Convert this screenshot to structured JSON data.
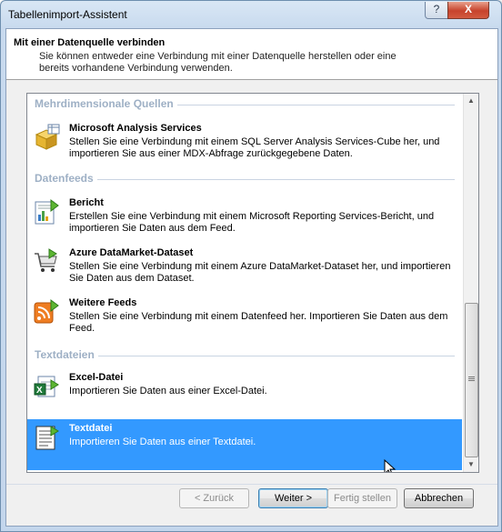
{
  "window": {
    "title": "Tabellenimport-Assistent",
    "help_glyph": "?",
    "close_glyph": "X"
  },
  "header": {
    "title": "Mit einer Datenquelle verbinden",
    "description": "Sie können entweder eine Verbindung mit einer Datenquelle herstellen oder eine bereits vorhandene Verbindung verwenden."
  },
  "groups": {
    "multidim": "Mehrdimensionale Quellen",
    "feeds": "Datenfeeds",
    "text": "Textdateien"
  },
  "items": [
    {
      "name": "Microsoft Analysis Services",
      "desc": "Stellen Sie eine Verbindung mit einem SQL Server Analysis Services-Cube her, und importieren Sie aus einer MDX-Abfrage zurückgegebene Daten.",
      "icon": "cube-icon"
    },
    {
      "name": "Bericht",
      "desc": "Erstellen Sie eine Verbindung mit einem Microsoft Reporting Services-Bericht, und importieren Sie Daten aus dem Feed.",
      "icon": "report-icon"
    },
    {
      "name": "Azure DataMarket-Dataset",
      "desc": "Stellen Sie eine Verbindung mit einem Azure DataMarket-Dataset her, und importieren Sie Daten aus dem Dataset.",
      "icon": "cart-icon"
    },
    {
      "name": "Weitere Feeds",
      "desc": "Stellen Sie eine Verbindung mit einem Datenfeed her. Importieren Sie Daten aus dem Feed.",
      "icon": "feed-icon"
    },
    {
      "name": "Excel-Datei",
      "desc": "Importieren Sie Daten aus einer Excel-Datei.",
      "icon": "excel-icon"
    },
    {
      "name": "Textdatei",
      "desc": "Importieren Sie Daten aus einer Textdatei.",
      "icon": "textfile-icon"
    }
  ],
  "buttons": {
    "back": "< Zurück",
    "next": "Weiter >",
    "finish": "Fertig stellen",
    "cancel": "Abbrechen"
  },
  "colors": {
    "selection": "#3399ff",
    "group_text": "#9eb0c5"
  }
}
